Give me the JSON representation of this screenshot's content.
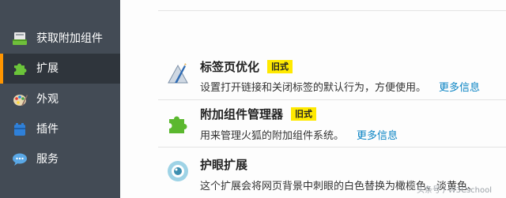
{
  "sidebar": {
    "items": [
      {
        "label": "获取附加组件",
        "icon": "get-addons-icon",
        "active": false
      },
      {
        "label": "扩展",
        "icon": "puzzle-icon",
        "active": true
      },
      {
        "label": "外观",
        "icon": "palette-icon",
        "active": false
      },
      {
        "label": "插件",
        "icon": "plugin-block-icon",
        "active": false
      },
      {
        "label": "服务",
        "icon": "speech-bubble-icon",
        "active": false
      }
    ]
  },
  "addons": [
    {
      "name": "标签页优化",
      "badge": "旧式",
      "description": "设置打开链接和关闭标签的默认行为，方便使用。",
      "more": "更多信息",
      "icon": "pen-ruler-icon"
    },
    {
      "name": "附加组件管理器",
      "badge": "旧式",
      "description": "用来管理火狐的附加组件系统。",
      "more": "更多信息",
      "icon": "green-puzzle-icon"
    },
    {
      "name": "护眼扩展",
      "badge": "",
      "description": "这个扩展会将网页背景中刺眼的白色替换为橄榄色、淡黄色、",
      "more": "",
      "icon": "eye-icon"
    }
  ],
  "watermark": "头条号 / W3Cschool",
  "colors": {
    "sidebar": "#434b55",
    "active": "#2f353c",
    "accent": "#ff9500",
    "badge": "#ffe900",
    "link": "#0a84c4"
  }
}
